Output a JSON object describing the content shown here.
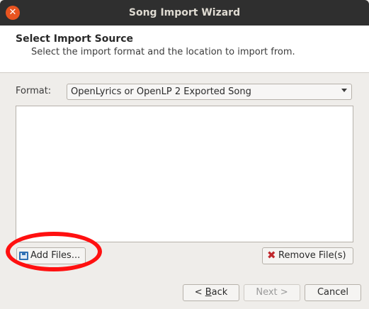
{
  "window": {
    "title": "Song Import Wizard"
  },
  "header": {
    "title": "Select Import Source",
    "subtitle": "Select the import format and the location to import from."
  },
  "format": {
    "label": "Format:",
    "selected": "OpenLyrics or OpenLP 2 Exported Song"
  },
  "file_list": {
    "items": []
  },
  "buttons": {
    "add_files": "Add Files...",
    "remove_files": "Remove File(s)",
    "back_mnemonic": "B",
    "back_rest": "ack",
    "back_prefix": "< ",
    "next": "Next >",
    "cancel": "Cancel"
  },
  "colors": {
    "titlebar": "#2f2f2f",
    "close_button": "#e95420",
    "highlight_annotation": "#ff1010"
  }
}
